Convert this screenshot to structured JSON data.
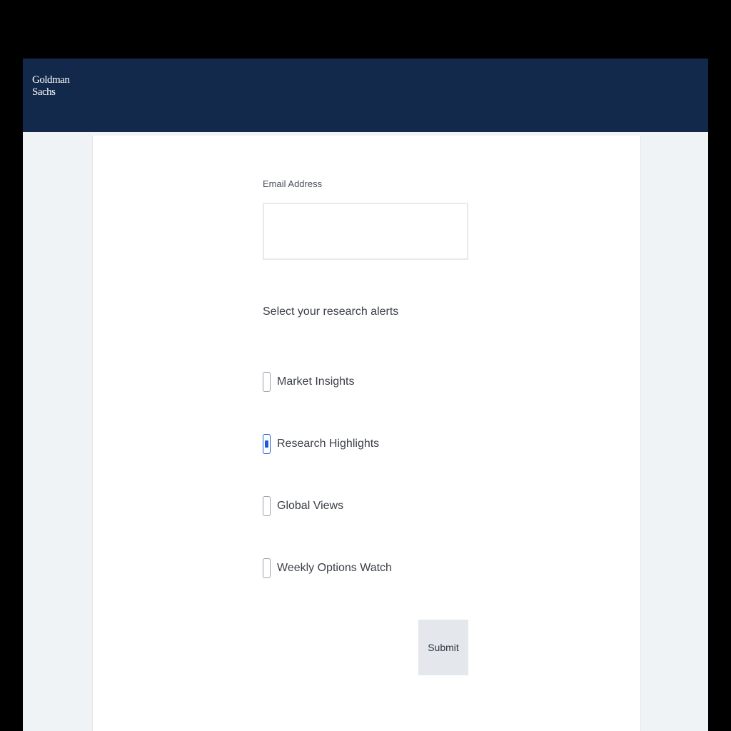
{
  "header": {
    "logo_line1": "Goldman",
    "logo_line2": "Sachs"
  },
  "colors": {
    "header_bg": "#13294b",
    "checkbox_checked": "#1d5bd6",
    "submit_bg": "#e4e8ec"
  },
  "form": {
    "email_label": "Email Address",
    "email_value": "",
    "alerts_heading": "Select your research alerts",
    "options": [
      {
        "label": "Market Insights",
        "checked": false
      },
      {
        "label": "Research Highlights",
        "checked": true
      },
      {
        "label": "Global Views",
        "checked": false
      },
      {
        "label": "Weekly Options Watch",
        "checked": false
      }
    ],
    "submit_label": "Submit"
  }
}
